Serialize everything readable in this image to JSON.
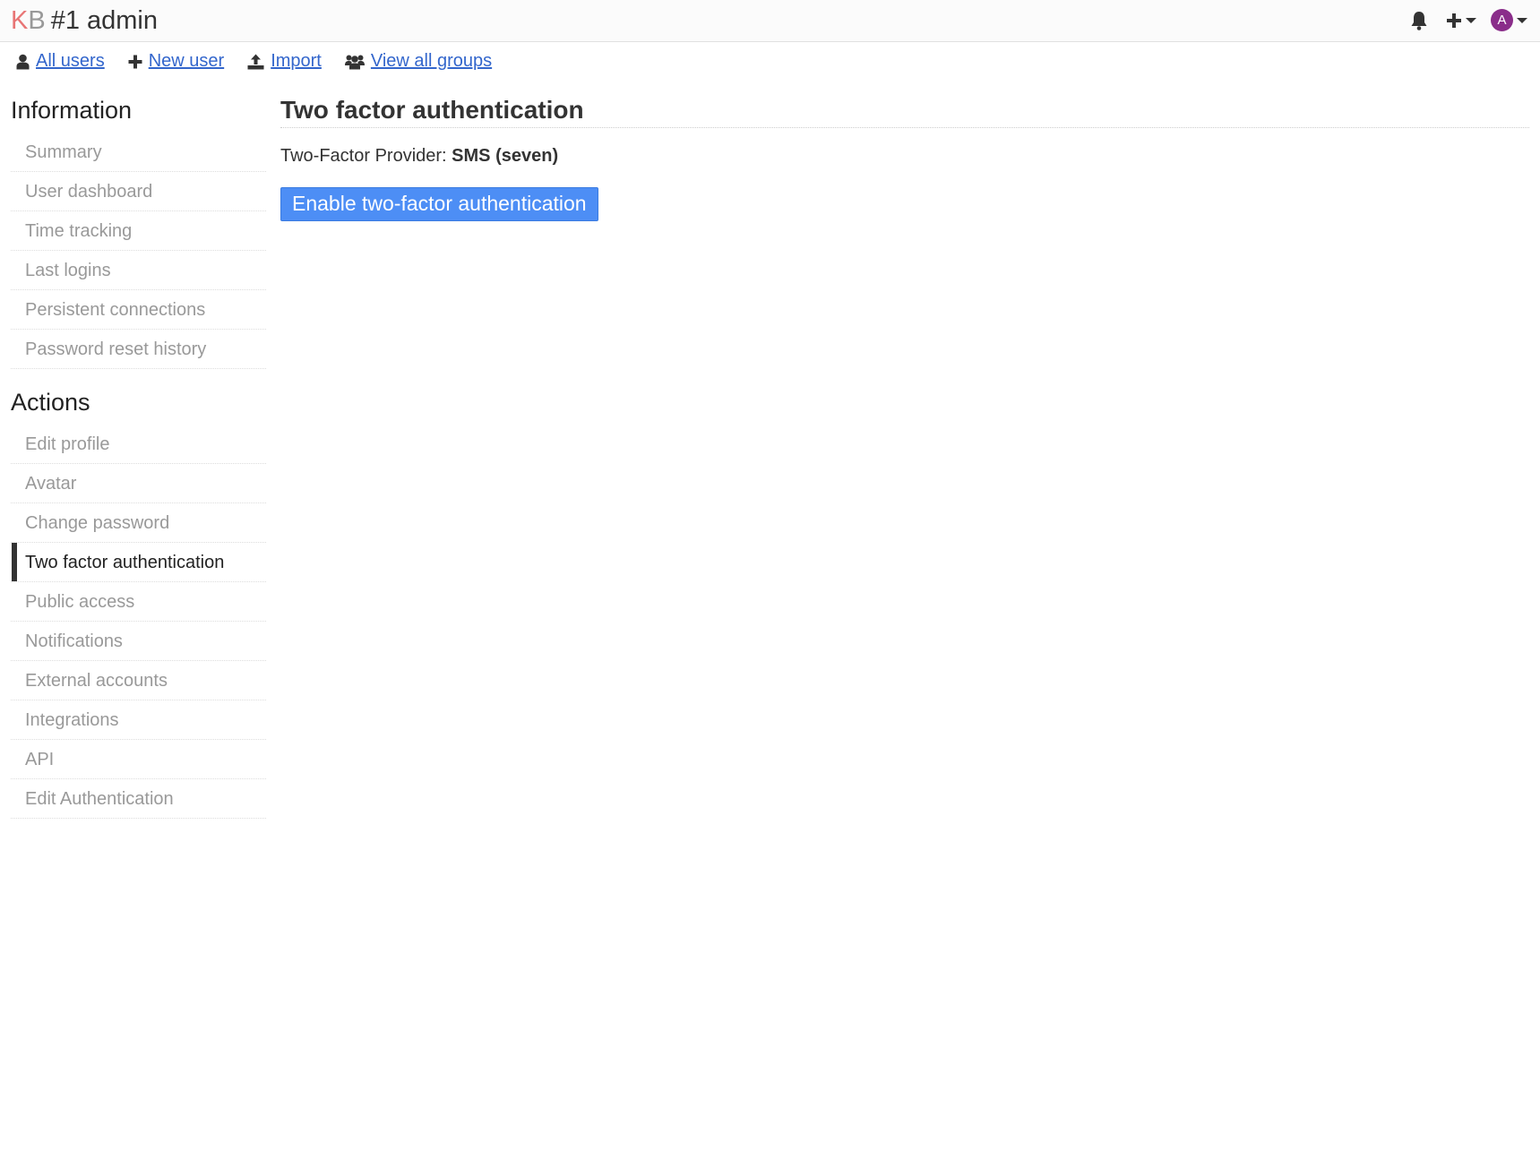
{
  "header": {
    "logo_k": "K",
    "logo_b": "B",
    "title": "#1 admin",
    "icons": [
      "bell-icon",
      "plus-icon",
      "avatar"
    ],
    "avatar_letter": "A",
    "avatar_color": "#8a2d8a"
  },
  "subnav": [
    {
      "icon": "user-icon",
      "label": "All users"
    },
    {
      "icon": "plus-icon",
      "label": "New user"
    },
    {
      "icon": "upload-icon",
      "label": "Import"
    },
    {
      "icon": "users-icon",
      "label": "View all groups"
    }
  ],
  "sidebar": {
    "information_heading": "Information",
    "information_items": [
      {
        "label": "Summary"
      },
      {
        "label": "User dashboard"
      },
      {
        "label": "Time tracking"
      },
      {
        "label": "Last logins"
      },
      {
        "label": "Persistent connections"
      },
      {
        "label": "Password reset history"
      }
    ],
    "actions_heading": "Actions",
    "actions_items": [
      {
        "label": "Edit profile"
      },
      {
        "label": "Avatar"
      },
      {
        "label": "Change password"
      },
      {
        "label": "Two factor authentication",
        "active": true
      },
      {
        "label": "Public access"
      },
      {
        "label": "Notifications"
      },
      {
        "label": "External accounts"
      },
      {
        "label": "Integrations"
      },
      {
        "label": "API"
      },
      {
        "label": "Edit Authentication"
      }
    ]
  },
  "main": {
    "title": "Two factor authentication",
    "provider_label": "Two-Factor Provider:",
    "provider_value": "SMS (seven)",
    "enable_button": "Enable two-factor authentication",
    "button_color": "#4d8ef5"
  }
}
